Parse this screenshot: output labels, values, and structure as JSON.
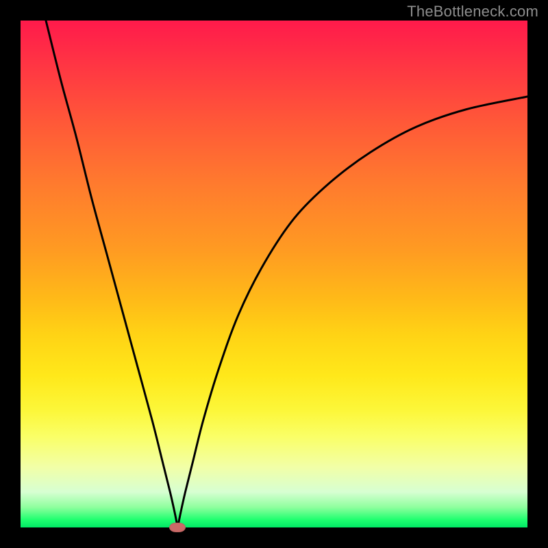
{
  "watermark": "TheBottleneck.com",
  "chart_data": {
    "type": "line",
    "title": "",
    "xlabel": "",
    "ylabel": "",
    "xlim": [
      0,
      100
    ],
    "ylim": [
      0,
      100
    ],
    "grid": false,
    "legend": false,
    "background_gradient": {
      "top": "#ff1a4b",
      "bottom": "#00e865",
      "stops": [
        "red",
        "orange",
        "yellow",
        "green"
      ]
    },
    "marker": {
      "x": 31.0,
      "y": 0.0,
      "color": "#cb6a68",
      "shape": "rounded-rectangle"
    },
    "series": [
      {
        "name": "left-branch",
        "x": [
          5,
          8,
          11,
          14,
          17,
          20,
          23,
          26,
          28,
          29.5,
          30.4,
          31
        ],
        "y": [
          100,
          88,
          77,
          65,
          54,
          43,
          32,
          21,
          13,
          7,
          3,
          0
        ]
      },
      {
        "name": "right-branch",
        "x": [
          31,
          31.6,
          32.5,
          34,
          36,
          39,
          43,
          48,
          54,
          61,
          69,
          78,
          88,
          100
        ],
        "y": [
          0,
          3,
          7,
          13,
          21,
          31,
          42,
          52,
          61,
          68,
          74,
          79,
          82.5,
          85
        ]
      }
    ]
  }
}
